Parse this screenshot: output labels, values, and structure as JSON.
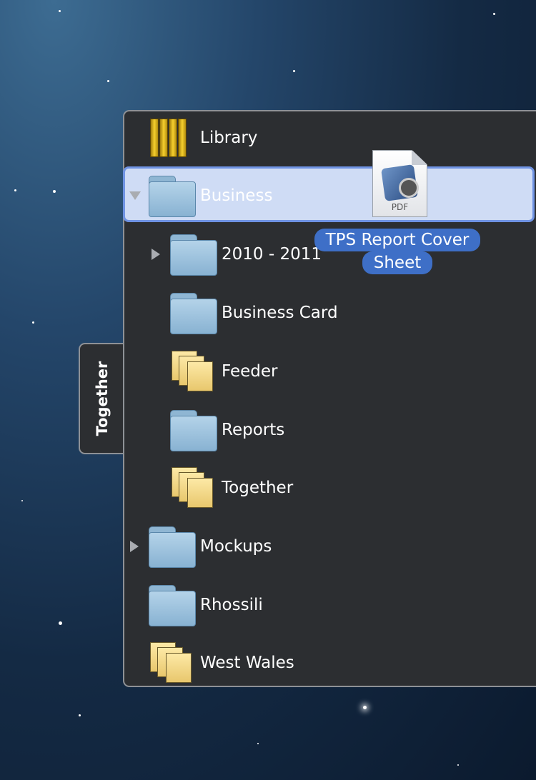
{
  "sidebar": {
    "tab_label": "Together",
    "items": [
      {
        "label": "Library",
        "icon": "library-books-icon",
        "indent": 0,
        "disclosure": "none",
        "selected": false
      },
      {
        "label": "Business",
        "icon": "folder-icon",
        "indent": 0,
        "disclosure": "expanded",
        "selected": true
      },
      {
        "label": "2010 - 2011",
        "icon": "folder-icon",
        "indent": 1,
        "disclosure": "collapsed",
        "selected": false
      },
      {
        "label": "Business Card",
        "icon": "folder-icon",
        "indent": 1,
        "disclosure": "none",
        "selected": false
      },
      {
        "label": "Feeder",
        "icon": "stacked-documents-icon",
        "indent": 1,
        "disclosure": "none",
        "selected": false
      },
      {
        "label": "Reports",
        "icon": "folder-icon",
        "indent": 1,
        "disclosure": "none",
        "selected": false
      },
      {
        "label": "Together",
        "icon": "stacked-documents-icon",
        "indent": 1,
        "disclosure": "none",
        "selected": false
      },
      {
        "label": "Mockups",
        "icon": "folder-icon",
        "indent": 0,
        "disclosure": "collapsed",
        "selected": false
      },
      {
        "label": "Rhossili",
        "icon": "folder-icon",
        "indent": 0,
        "disclosure": "none",
        "selected": false
      },
      {
        "label": "West Wales",
        "icon": "stacked-documents-icon",
        "indent": 0,
        "disclosure": "none",
        "selected": false
      }
    ]
  },
  "drag": {
    "file_type_label": "PDF",
    "file_name_line1": "TPS Report Cover",
    "file_name_line2": "Sheet",
    "icon": "pdf-document-icon"
  },
  "colors": {
    "panel_bg": "#2c2e31",
    "panel_border": "#8e9196",
    "selection_fill": "#cfdcf5",
    "selection_border": "#6f93e3",
    "drag_label_bg": "#3e6fc7"
  }
}
